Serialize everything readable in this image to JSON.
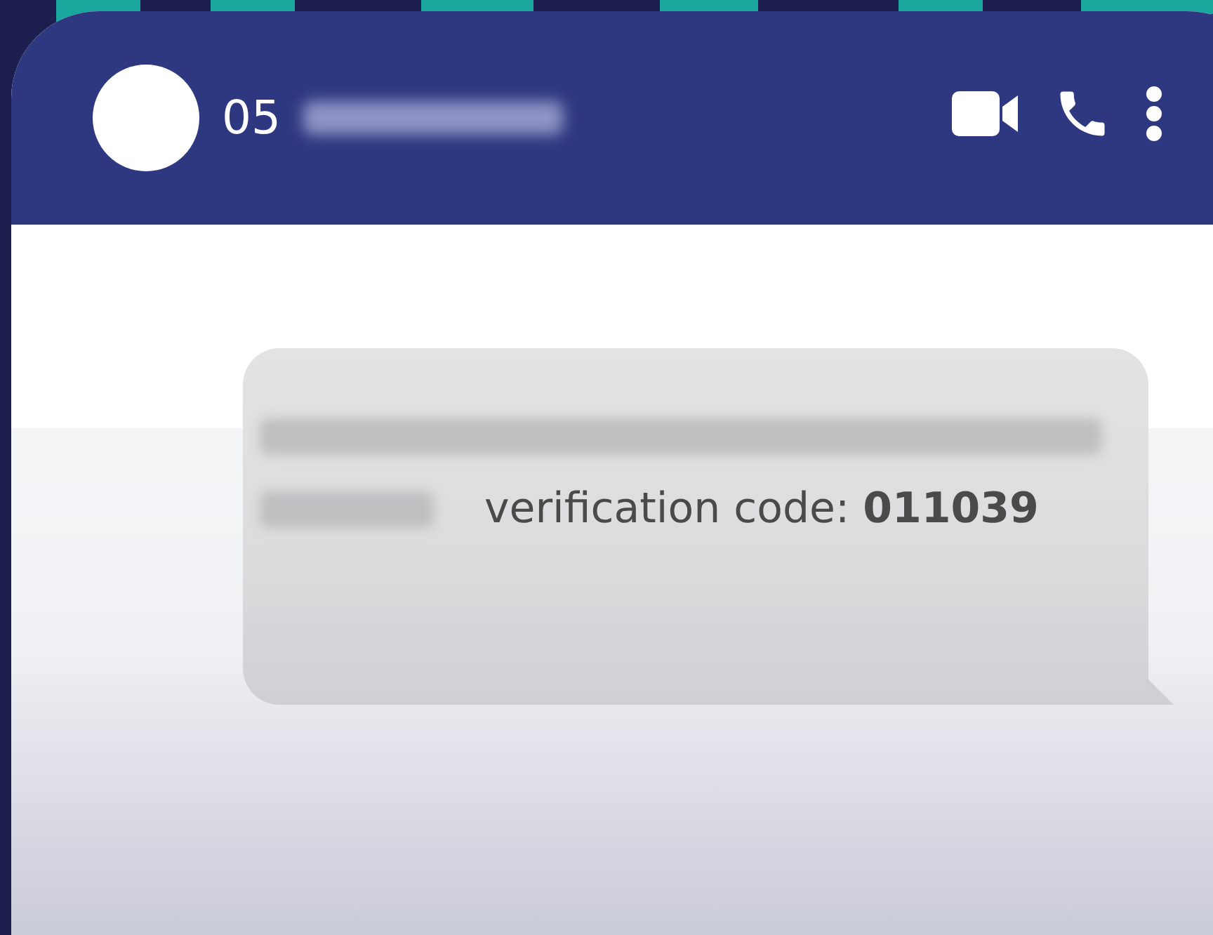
{
  "header": {
    "contact_name": "05"
  },
  "messages": [
    {
      "text": "verification code: **011039**"
    }
  ]
}
